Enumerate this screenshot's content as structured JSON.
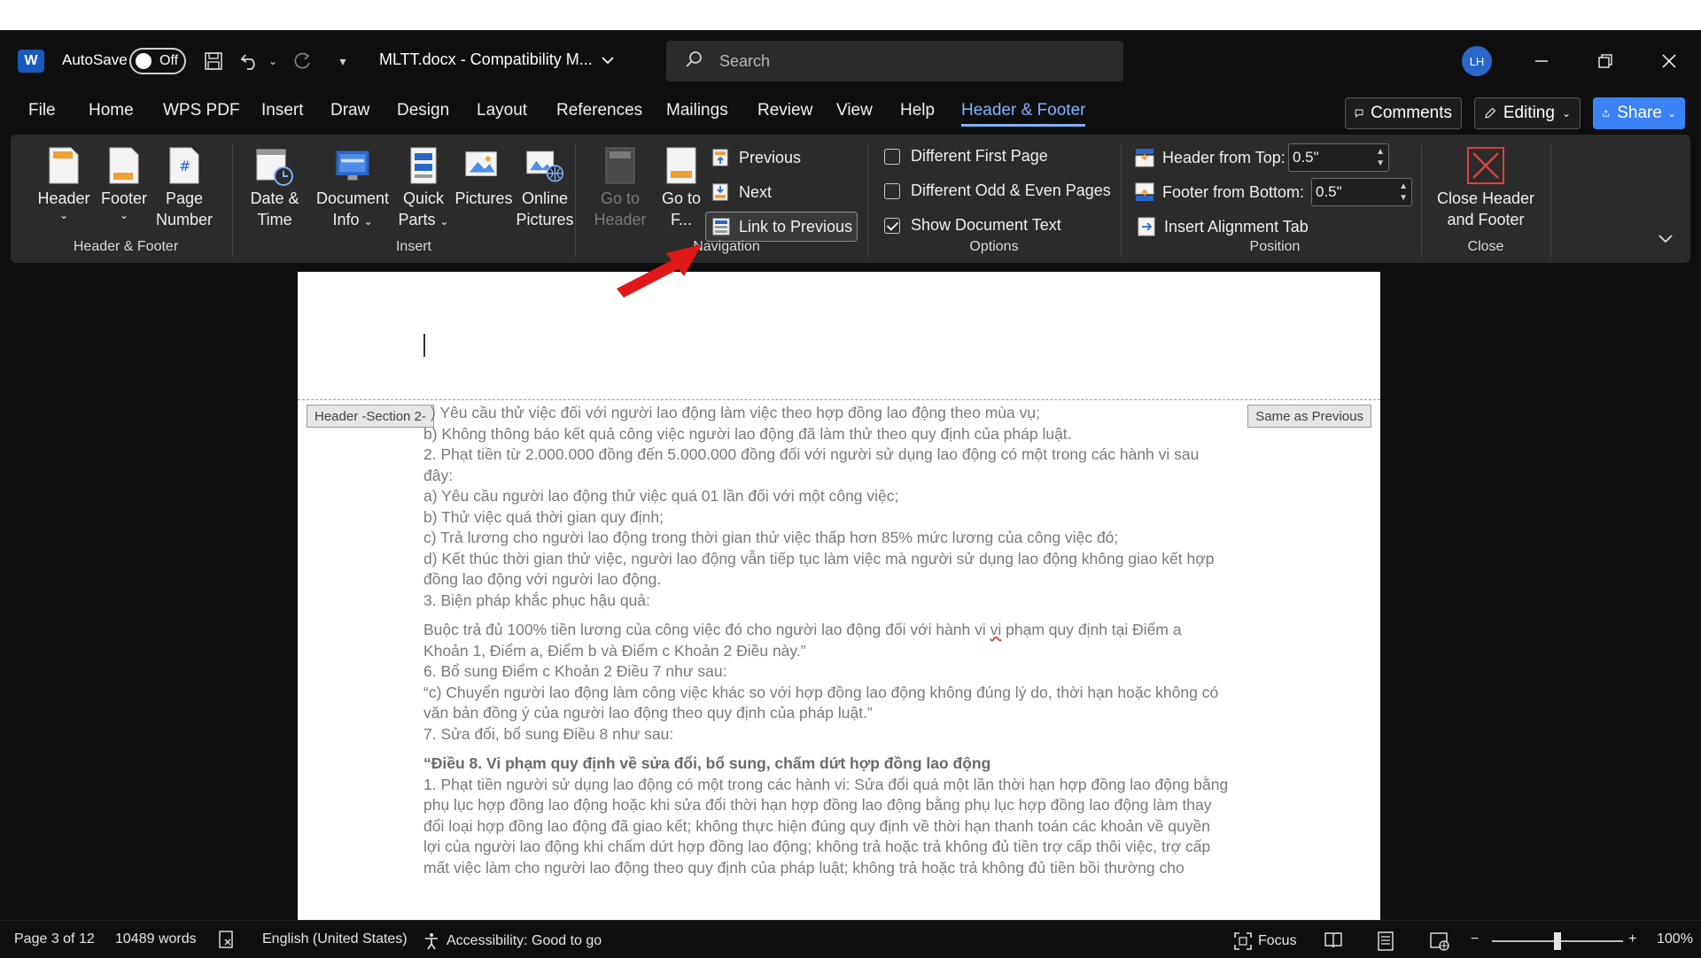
{
  "titlebar": {
    "autosave_label": "AutoSave",
    "autosave_state": "Off",
    "doc_title": "MLTT.docx  -  Compatibility M...",
    "search_placeholder": "Search",
    "avatar_initials": "LH",
    "app_icon": "word-icon"
  },
  "menu": {
    "tabs": [
      "File",
      "Home",
      "WPS PDF",
      "Insert",
      "Draw",
      "Design",
      "Layout",
      "References",
      "Mailings",
      "Review",
      "View",
      "Help",
      "Header & Footer"
    ],
    "active_tab": "Header & Footer",
    "comments_label": "Comments",
    "editing_label": "Editing",
    "share_label": "Share"
  },
  "ribbon": {
    "header_footer_group": {
      "label": "Header & Footer",
      "header": "Header",
      "footer": "Footer",
      "page_number": "Page\nNumber"
    },
    "insert_group": {
      "label": "Insert",
      "date_time": "Date &\nTime",
      "document_info": "Document\nInfo",
      "quick_parts": "Quick\nParts",
      "pictures": "Pictures",
      "online_pictures": "Online\nPictures"
    },
    "navigation_group": {
      "label": "Navigation",
      "go_to_header": "Go to\nHeader",
      "go_to_footer": "Go to\nF...",
      "previous": "Previous",
      "next": "Next",
      "link_to_previous": "Link to Previous"
    },
    "options_group": {
      "label": "Options",
      "different_first_page": "Different First Page",
      "different_first_page_checked": false,
      "different_odd_even": "Different Odd & Even Pages",
      "different_odd_even_checked": false,
      "show_document_text": "Show Document Text",
      "show_document_text_checked": true
    },
    "position_group": {
      "label": "Position",
      "header_from_top": "Header from Top:",
      "header_from_top_value": "0.5\"",
      "footer_from_bottom": "Footer from Bottom:",
      "footer_from_bottom_value": "0.5\"",
      "insert_alignment_tab": "Insert Alignment Tab"
    },
    "close_group": {
      "label": "Close",
      "close_header_footer": "Close Header\nand Footer"
    }
  },
  "document": {
    "header_section_tag": "Header -Section 2-",
    "same_as_previous_tag": "Same as Previous",
    "lines": [
      ") Yêu cầu thử việc đối với người lao động làm việc theo hợp đồng lao động theo mùa vụ;",
      "b) Không thông báo kết quả công việc người lao động đã làm thử theo quy định của pháp luật.",
      "2. Phạt tiền từ 2.000.000 đồng đến 5.000.000 đồng đối với người sử dụng lao động có một trong các hành vi sau",
      "đây:",
      "a) Yêu cầu người lao động thử việc quá 01 lần đối với một công việc;",
      "b) Thử việc quá thời gian quy định;",
      "c) Trả lương cho người lao động trong thời gian thử việc thấp hơn 85% mức lương của công việc đó;",
      "d) Kết thúc thời gian thử việc, người lao động vẫn tiếp tục làm việc mà người sử dụng lao động không giao kết hợp",
      "đồng lao động với người lao động.",
      "3. Biện pháp khắc phục hậu quả:"
    ],
    "para2_before": "Buộc trả đủ 100% tiền lương của công việc đó cho người lao động đối với hành vi ",
    "para2_squiggle": "vi",
    "para2_after": " phạm quy định tại Điểm a",
    "lines2": [
      "Khoản 1, Điểm a, Điểm b và Điểm c Khoản 2 Điều này.”",
      "6. Bổ sung Điểm c Khoản 2 Điều 7 như sau:",
      "“c) Chuyển người lao động làm công việc khác so với hợp đồng lao động không đúng lý do, thời hạn hoặc không có",
      "văn bản đồng ý của người lao động theo quy định của pháp luật.”",
      "7. Sửa đổi, bổ sung Điều 8 như sau:"
    ],
    "bold_heading": "“Điều 8. Vi phạm quy định về sửa đổi, bổ sung, chấm dứt hợp đồng lao động",
    "lines3": [
      "1. Phạt tiền người sử dụng lao động có một trong các hành vi: Sửa đổi quá một lần thời hạn hợp đồng lao động bằng",
      "phụ lục hợp đồng lao động hoặc khi sửa đổi thời hạn hợp đồng lao động bằng phụ lục hợp đồng lao động làm thay",
      "đổi loại hợp đồng lao động đã giao kết; không thực hiện đúng quy định về thời hạn thanh toán các khoản về quyền",
      "lợi của người lao động khi chấm dứt hợp đồng lao động; không trả hoặc trả không đủ tiền trợ cấp thôi việc, trợ cấp",
      "mất việc làm cho người lao động theo quy định của pháp luật; không trả hoặc trả không đủ tiền bồi thường cho"
    ]
  },
  "status": {
    "page": "Page 3 of 12",
    "words": "10489 words",
    "language": "English (United States)",
    "accessibility": "Accessibility: Good to go",
    "focus": "Focus",
    "zoom_minus": "−",
    "zoom_plus": "+",
    "zoom_level": "100%",
    "zoom_fraction": 0.5
  }
}
